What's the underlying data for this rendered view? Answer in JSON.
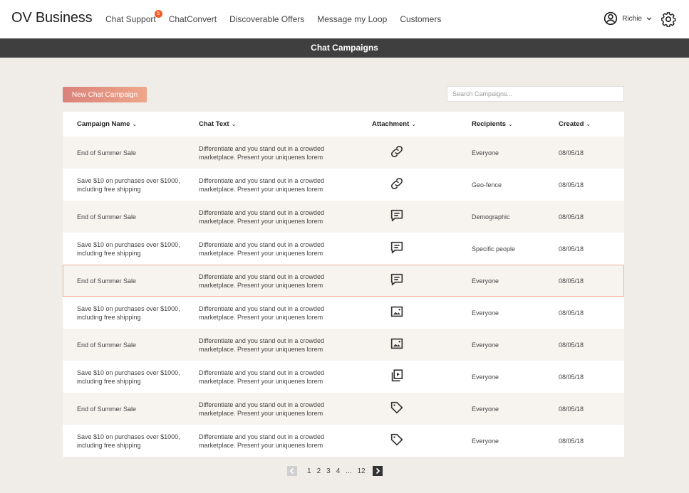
{
  "nav": {
    "logo": "OV Business",
    "links": [
      {
        "label": "Chat Support",
        "badge": "5"
      },
      {
        "label": "ChatConvert"
      },
      {
        "label": "Discoverable Offers"
      },
      {
        "label": "Message my Loop"
      },
      {
        "label": "Customers"
      }
    ],
    "user_name": "Richie",
    "user_menu_icon": "chevron-down-icon",
    "settings_icon": "gear-icon"
  },
  "page_title": "Chat Campaigns",
  "toolbar": {
    "new_button_label": "New Chat Campaign",
    "search_placeholder": "Search Campaigns..."
  },
  "table": {
    "columns": [
      "Campaign Name",
      "Chat Text",
      "Attachment",
      "Recipients",
      "Created"
    ],
    "rows": [
      {
        "name": "End of Summer Sale",
        "text": "Differentiate and you stand out in a crowded marketplace. Present your uniquenes lorem",
        "attachment": "link-icon",
        "recipients": "Everyone",
        "created": "08/05/18"
      },
      {
        "name": "Save $10 on purchases over $1000, including free shipping",
        "text": "Differentiate and you stand out in a crowded marketplace. Present your uniquenes lorem",
        "attachment": "link-icon",
        "recipients": "Geo-fence",
        "created": "08/05/18"
      },
      {
        "name": "End of Summer Sale",
        "text": "Differentiate and you stand out in a crowded marketplace. Present your uniquenes lorem",
        "attachment": "message-icon",
        "recipients": "Demographic",
        "created": "08/05/18"
      },
      {
        "name": "Save $10 on purchases over $1000, including free shipping",
        "text": "Differentiate and you stand out in a crowded marketplace. Present your uniquenes lorem",
        "attachment": "message-icon",
        "recipients": "Specific people",
        "created": "08/05/18"
      },
      {
        "name": "End of Summer Sale",
        "text": "Differentiate and you stand out in a crowded marketplace. Present your uniquenes lorem",
        "attachment": "message-icon",
        "recipients": "Everyone",
        "created": "08/05/18",
        "selected": true
      },
      {
        "name": "Save $10 on purchases over $1000, including free shipping",
        "text": "Differentiate and you stand out in a crowded marketplace. Present your uniquenes lorem",
        "attachment": "image-icon",
        "recipients": "Everyone",
        "created": "08/05/18"
      },
      {
        "name": "End of Summer Sale",
        "text": "Differentiate and you stand out in a crowded marketplace. Present your uniquenes lorem",
        "attachment": "image-icon",
        "recipients": "Everyone",
        "created": "08/05/18"
      },
      {
        "name": "Save $10 on purchases over $1000, including free shipping",
        "text": "Differentiate and you stand out in a crowded marketplace. Present your uniquenes lorem",
        "attachment": "video-icon",
        "recipients": "Everyone",
        "created": "08/05/18"
      },
      {
        "name": "End of Summer Sale",
        "text": "Differentiate and you stand out in a crowded marketplace. Present your uniquenes lorem",
        "attachment": "tag-icon",
        "recipients": "Everyone",
        "created": "08/05/18"
      },
      {
        "name": "Save $10 on purchases over $1000, including free shipping",
        "text": "Differentiate and you stand out in a crowded marketplace. Present your uniquenes lorem",
        "attachment": "tag-icon",
        "recipients": "Everyone",
        "created": "08/05/18"
      }
    ]
  },
  "pagination": {
    "pages": [
      "1",
      "2",
      "3",
      "4",
      "...",
      "12"
    ],
    "prev_icon": "chevron-left-icon",
    "next_icon": "chevron-right-icon"
  },
  "colors": {
    "accent": "#f15a24",
    "button_gradient_start": "#d9827a",
    "button_gradient_end": "#efa68a",
    "title_bar": "#3f3f3f",
    "selected_border": "#f2b08e"
  }
}
